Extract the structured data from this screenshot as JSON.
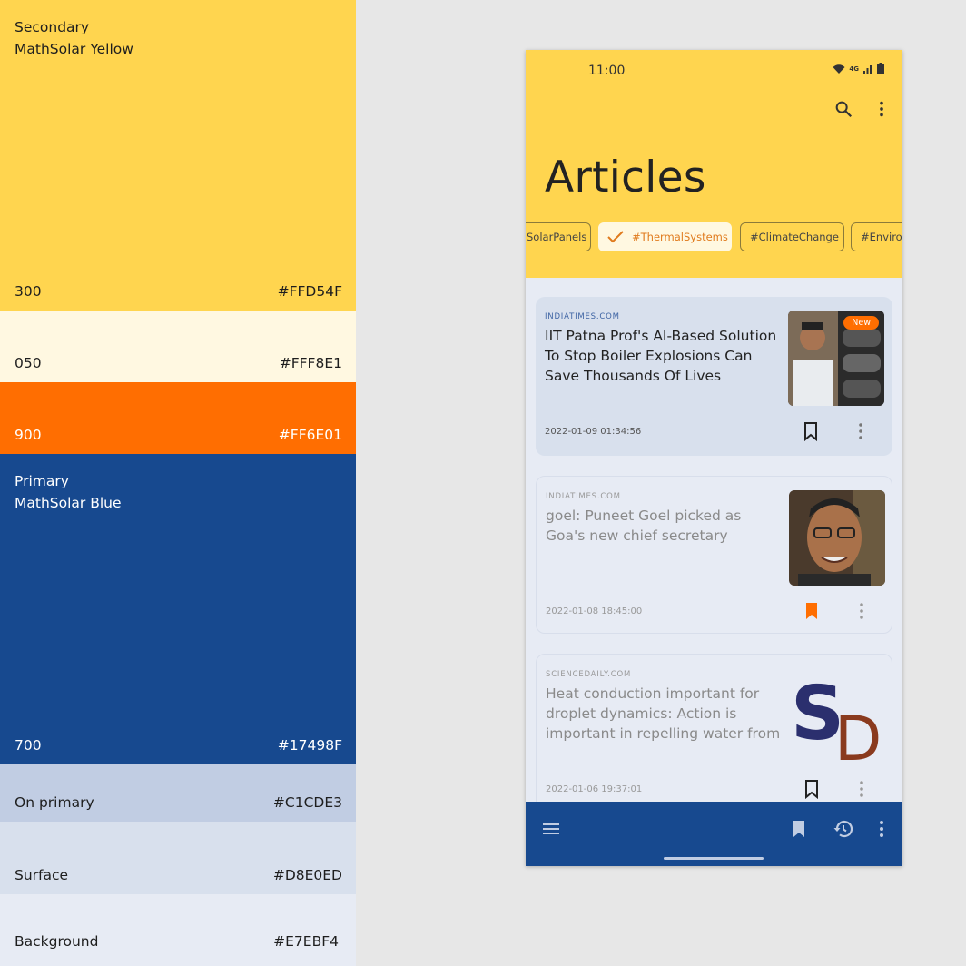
{
  "palette": {
    "secondary": {
      "title": "Secondary",
      "name": "MathSolar Yellow",
      "shade": "300",
      "hex": "#FFD54F"
    },
    "secondary_050": {
      "shade": "050",
      "hex": "#FFF8E1"
    },
    "secondary_900": {
      "shade": "900",
      "hex": "#FF6E01"
    },
    "primary": {
      "title": "Primary",
      "name": "MathSolar Blue",
      "shade": "700",
      "hex": "#17498F"
    },
    "on_primary": {
      "label": "On primary",
      "hex": "#C1CDE3"
    },
    "surface": {
      "label": "Surface",
      "hex": "#D8E0ED"
    },
    "background": {
      "label": "Background",
      "hex": "#E7EBF4"
    }
  },
  "phone": {
    "status": {
      "time": "11:00",
      "network": "4G"
    },
    "app_bar": {
      "title": "Articles",
      "actions": [
        "search-icon",
        "more-vert-icon"
      ]
    },
    "chips": [
      {
        "label": "#SolarPanels",
        "visible_text": "SolarPanels",
        "selected": false
      },
      {
        "label": "#ThermalSystems",
        "selected": true
      },
      {
        "label": "#ClimateChange",
        "selected": false
      },
      {
        "label": "#Environ",
        "selected": false
      }
    ],
    "articles": [
      {
        "source": "INDIATIMES.COM",
        "headline": "IIT Patna Prof's AI-Based Solution To Stop Boiler Explosions Can Save Thousands Of Lives",
        "date": "2022-01-09 01:34:56",
        "badge": "New",
        "bookmarked": false,
        "read": false
      },
      {
        "source": "INDIATIMES.COM",
        "headline": "goel: Puneet Goel picked as Goa's new chief secretary",
        "date": "2022-01-08 18:45:00",
        "bookmarked": true,
        "read": true
      },
      {
        "source": "SCIENCEDAILY.COM",
        "headline": "Heat conduction important for droplet dynamics: Action is important in repelling water from",
        "date": "2022-01-06 19:37:01",
        "bookmarked": false,
        "read": true,
        "thumb_text": [
          "S",
          "D"
        ]
      }
    ],
    "bottom_bar": {
      "icons": [
        "menu-icon",
        "bookmark-icon",
        "history-icon",
        "more-vert-icon"
      ]
    }
  }
}
